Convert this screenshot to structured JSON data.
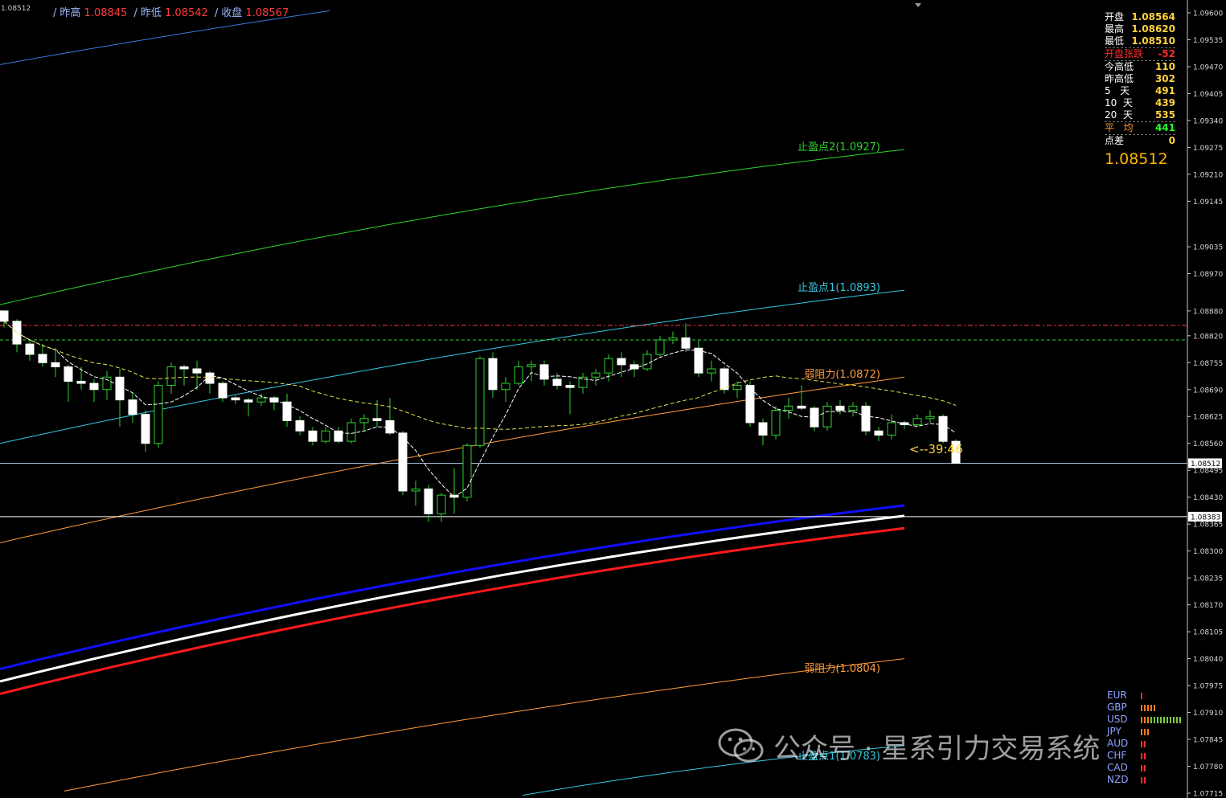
{
  "header": {
    "corner_price": "1.08512",
    "items": [
      {
        "label": "昨高",
        "value": "1.08845"
      },
      {
        "label": "昨低",
        "value": "1.08542"
      },
      {
        "label": "收盘",
        "value": "1.08567"
      }
    ]
  },
  "stats": {
    "rows": [
      {
        "label": "开盘",
        "value": "1.08564"
      },
      {
        "label": "最高",
        "value": "1.08620"
      },
      {
        "label": "最低",
        "value": "1.08510"
      },
      {
        "label": "开盘张跌",
        "value": "-52"
      },
      {
        "label": "今高低",
        "value": "110"
      },
      {
        "label": "昨高低",
        "value": "302"
      },
      {
        "label": "5   天",
        "value": "491"
      },
      {
        "label": "10  天",
        "value": "439"
      },
      {
        "label": "20  天",
        "value": "535"
      },
      {
        "label": "平   均",
        "value": "441"
      },
      {
        "label": "点差",
        "value": "0"
      }
    ],
    "current_price": "1.08512"
  },
  "countdown": "<--39:46",
  "currencies": [
    {
      "name": "EUR",
      "bars": 1,
      "color": "#ff2b2b"
    },
    {
      "name": "GBP",
      "bars": 5,
      "color": "#ff7a1a"
    },
    {
      "name": "USD",
      "bars": 13,
      "color": "#7ac943"
    },
    {
      "name": "JPY",
      "bars": 3,
      "color": "#ff7a1a"
    },
    {
      "name": "AUD",
      "bars": 2,
      "color": "#ff2b2b"
    },
    {
      "name": "CHF",
      "bars": 2,
      "color": "#ff2b2b"
    },
    {
      "name": "CAD",
      "bars": 2,
      "color": "#ff2b2b"
    },
    {
      "name": "NZD",
      "bars": 2,
      "color": "#ff2b2b"
    }
  ],
  "watermark": {
    "text": "公众号 · 星系引力交易系统",
    "icon": "wechat-icon"
  },
  "colors": {
    "background": "#000000",
    "bull_candle": "#ffffff",
    "bear_candle": "#000000",
    "wick": "#2bd52b",
    "tp2": "#2bd52b",
    "tp1": "#35c8e0",
    "resistance": "#ff9c3a",
    "ma_blue": "#1010ff",
    "ma_white": "#ffffff",
    "ma_red": "#ff1a1a"
  },
  "chart_data": {
    "type": "candlestick",
    "y_axis": {
      "range": [
        1.077,
        1.0962
      ],
      "ticks": [
        "1.09600",
        "1.09535",
        "1.09470",
        "1.09405",
        "1.09340",
        "1.09275",
        "1.09210",
        "1.09145",
        "1.09035",
        "1.08970",
        "1.08880",
        "1.08820",
        "1.08755",
        "1.08690",
        "1.08625",
        "1.08560",
        "1.08495",
        "1.08430",
        "1.08365",
        "1.08300",
        "1.08235",
        "1.08170",
        "1.08105",
        "1.08040",
        "1.07975",
        "1.07910",
        "1.07845",
        "1.07780",
        "1.07715"
      ],
      "current_price_tag": "1.08512",
      "line_price_tag": "1.08383"
    },
    "candles": [
      {
        "o": 1.0888,
        "h": 1.0887,
        "l": 1.0884,
        "c": 1.08855
      },
      {
        "o": 1.08855,
        "h": 1.0886,
        "l": 1.0878,
        "c": 1.088
      },
      {
        "o": 1.088,
        "h": 1.0881,
        "l": 1.0876,
        "c": 1.08775
      },
      {
        "o": 1.08775,
        "h": 1.088,
        "l": 1.08745,
        "c": 1.08755
      },
      {
        "o": 1.08755,
        "h": 1.0879,
        "l": 1.0872,
        "c": 1.08745
      },
      {
        "o": 1.08745,
        "h": 1.0875,
        "l": 1.0866,
        "c": 1.0871
      },
      {
        "o": 1.0871,
        "h": 1.08745,
        "l": 1.0869,
        "c": 1.08705
      },
      {
        "o": 1.08705,
        "h": 1.08715,
        "l": 1.0866,
        "c": 1.0869
      },
      {
        "o": 1.0869,
        "h": 1.08735,
        "l": 1.08665,
        "c": 1.0872
      },
      {
        "o": 1.0872,
        "h": 1.0874,
        "l": 1.086,
        "c": 1.08665
      },
      {
        "o": 1.08665,
        "h": 1.0868,
        "l": 1.0861,
        "c": 1.0863
      },
      {
        "o": 1.0863,
        "h": 1.0864,
        "l": 1.0854,
        "c": 1.0856
      },
      {
        "o": 1.0856,
        "h": 1.0871,
        "l": 1.0855,
        "c": 1.087
      },
      {
        "o": 1.087,
        "h": 1.08755,
        "l": 1.0868,
        "c": 1.08745
      },
      {
        "o": 1.08745,
        "h": 1.0875,
        "l": 1.087,
        "c": 1.0874
      },
      {
        "o": 1.0874,
        "h": 1.0876,
        "l": 1.0869,
        "c": 1.0873
      },
      {
        "o": 1.0873,
        "h": 1.08735,
        "l": 1.0868,
        "c": 1.08705
      },
      {
        "o": 1.08705,
        "h": 1.0871,
        "l": 1.0866,
        "c": 1.0867
      },
      {
        "o": 1.0867,
        "h": 1.08675,
        "l": 1.08655,
        "c": 1.08665
      },
      {
        "o": 1.08665,
        "h": 1.0867,
        "l": 1.08625,
        "c": 1.0866
      },
      {
        "o": 1.0866,
        "h": 1.0868,
        "l": 1.0865,
        "c": 1.0867
      },
      {
        "o": 1.0867,
        "h": 1.08675,
        "l": 1.0864,
        "c": 1.0866
      },
      {
        "o": 1.0866,
        "h": 1.0868,
        "l": 1.086,
        "c": 1.08615
      },
      {
        "o": 1.08615,
        "h": 1.08625,
        "l": 1.0858,
        "c": 1.0859
      },
      {
        "o": 1.0859,
        "h": 1.086,
        "l": 1.08555,
        "c": 1.08565
      },
      {
        "o": 1.08565,
        "h": 1.086,
        "l": 1.0856,
        "c": 1.0859
      },
      {
        "o": 1.0859,
        "h": 1.086,
        "l": 1.0856,
        "c": 1.08565
      },
      {
        "o": 1.08565,
        "h": 1.0862,
        "l": 1.0856,
        "c": 1.0861
      },
      {
        "o": 1.0861,
        "h": 1.0863,
        "l": 1.0859,
        "c": 1.0862
      },
      {
        "o": 1.0862,
        "h": 1.08665,
        "l": 1.086,
        "c": 1.08615
      },
      {
        "o": 1.08615,
        "h": 1.0867,
        "l": 1.0858,
        "c": 1.08585
      },
      {
        "o": 1.08585,
        "h": 1.0859,
        "l": 1.08435,
        "c": 1.08445
      },
      {
        "o": 1.08445,
        "h": 1.0847,
        "l": 1.0841,
        "c": 1.0845
      },
      {
        "o": 1.0845,
        "h": 1.0846,
        "l": 1.0837,
        "c": 1.0839
      },
      {
        "o": 1.0839,
        "h": 1.0844,
        "l": 1.0837,
        "c": 1.08435
      },
      {
        "o": 1.08435,
        "h": 1.085,
        "l": 1.0839,
        "c": 1.0843
      },
      {
        "o": 1.0843,
        "h": 1.0856,
        "l": 1.0842,
        "c": 1.08555
      },
      {
        "o": 1.08555,
        "h": 1.0877,
        "l": 1.0855,
        "c": 1.08765
      },
      {
        "o": 1.08765,
        "h": 1.0878,
        "l": 1.0867,
        "c": 1.0869
      },
      {
        "o": 1.0869,
        "h": 1.0872,
        "l": 1.0866,
        "c": 1.08705
      },
      {
        "o": 1.08705,
        "h": 1.0876,
        "l": 1.087,
        "c": 1.08745
      },
      {
        "o": 1.08745,
        "h": 1.0876,
        "l": 1.0871,
        "c": 1.0875
      },
      {
        "o": 1.0875,
        "h": 1.0876,
        "l": 1.087,
        "c": 1.08715
      },
      {
        "o": 1.08715,
        "h": 1.0873,
        "l": 1.0869,
        "c": 1.087
      },
      {
        "o": 1.087,
        "h": 1.0871,
        "l": 1.0863,
        "c": 1.08695
      },
      {
        "o": 1.08695,
        "h": 1.0873,
        "l": 1.0868,
        "c": 1.0872
      },
      {
        "o": 1.0872,
        "h": 1.0874,
        "l": 1.087,
        "c": 1.0873
      },
      {
        "o": 1.0873,
        "h": 1.08775,
        "l": 1.0871,
        "c": 1.08765
      },
      {
        "o": 1.08765,
        "h": 1.0878,
        "l": 1.0872,
        "c": 1.0875
      },
      {
        "o": 1.0875,
        "h": 1.0876,
        "l": 1.0872,
        "c": 1.0874
      },
      {
        "o": 1.0874,
        "h": 1.08785,
        "l": 1.08735,
        "c": 1.08775
      },
      {
        "o": 1.08775,
        "h": 1.0882,
        "l": 1.0877,
        "c": 1.0881
      },
      {
        "o": 1.0881,
        "h": 1.0883,
        "l": 1.088,
        "c": 1.08815
      },
      {
        "o": 1.08815,
        "h": 1.0885,
        "l": 1.0878,
        "c": 1.0879
      },
      {
        "o": 1.0879,
        "h": 1.0881,
        "l": 1.0872,
        "c": 1.0873
      },
      {
        "o": 1.0873,
        "h": 1.0876,
        "l": 1.0871,
        "c": 1.0874
      },
      {
        "o": 1.0874,
        "h": 1.08745,
        "l": 1.0868,
        "c": 1.0869
      },
      {
        "o": 1.0869,
        "h": 1.0871,
        "l": 1.0867,
        "c": 1.087
      },
      {
        "o": 1.087,
        "h": 1.0871,
        "l": 1.086,
        "c": 1.0861
      },
      {
        "o": 1.0861,
        "h": 1.0862,
        "l": 1.08555,
        "c": 1.0858
      },
      {
        "o": 1.0858,
        "h": 1.0865,
        "l": 1.0857,
        "c": 1.0864
      },
      {
        "o": 1.0864,
        "h": 1.0867,
        "l": 1.0862,
        "c": 1.0865
      },
      {
        "o": 1.0865,
        "h": 1.087,
        "l": 1.0864,
        "c": 1.08645
      },
      {
        "o": 1.08645,
        "h": 1.0865,
        "l": 1.0859,
        "c": 1.086
      },
      {
        "o": 1.086,
        "h": 1.0866,
        "l": 1.0859,
        "c": 1.0865
      },
      {
        "o": 1.0865,
        "h": 1.08665,
        "l": 1.0863,
        "c": 1.0864
      },
      {
        "o": 1.0864,
        "h": 1.0866,
        "l": 1.08625,
        "c": 1.0865
      },
      {
        "o": 1.0865,
        "h": 1.0866,
        "l": 1.0858,
        "c": 1.0859
      },
      {
        "o": 1.0859,
        "h": 1.086,
        "l": 1.08565,
        "c": 1.0858
      },
      {
        "o": 1.0858,
        "h": 1.0863,
        "l": 1.0857,
        "c": 1.0861
      },
      {
        "o": 1.0861,
        "h": 1.08615,
        "l": 1.08595,
        "c": 1.08605
      },
      {
        "o": 1.08605,
        "h": 1.0863,
        "l": 1.086,
        "c": 1.0862
      },
      {
        "o": 1.0862,
        "h": 1.0864,
        "l": 1.0861,
        "c": 1.08625
      },
      {
        "o": 1.08625,
        "h": 1.0863,
        "l": 1.0856,
        "c": 1.08565
      },
      {
        "o": 1.08565,
        "h": 1.0857,
        "l": 1.0851,
        "c": 1.08512
      }
    ],
    "levels": [
      {
        "label": "止盈点2(1.0927)",
        "value": 1.0927,
        "color": "#2bd52b"
      },
      {
        "label": "止盈点1(1.0893)",
        "value": 1.0893,
        "color": "#35c8e0"
      },
      {
        "label": "弱阻力(1.0872)",
        "value": 1.0872,
        "color": "#ff9c3a"
      },
      {
        "label": "弱阻力(1.0804)",
        "value": 1.0804,
        "color": "#ff9c3a"
      },
      {
        "label": "止盈点1(1.0783)",
        "value": 1.0783,
        "color": "#35c8e0"
      }
    ]
  }
}
